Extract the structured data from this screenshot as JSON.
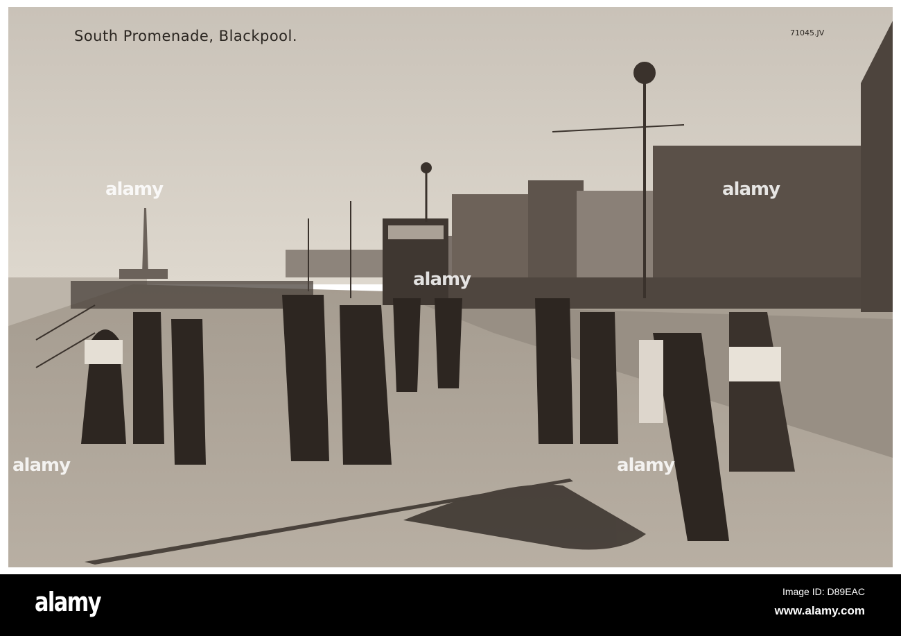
{
  "photo": {
    "caption": "South Promenade, Blackpool.",
    "code": "71045.JV",
    "watermark": "alamy"
  },
  "footer": {
    "brand": "alamy",
    "image_id": "Image ID: D89EAC",
    "website": "www.alamy.com"
  }
}
